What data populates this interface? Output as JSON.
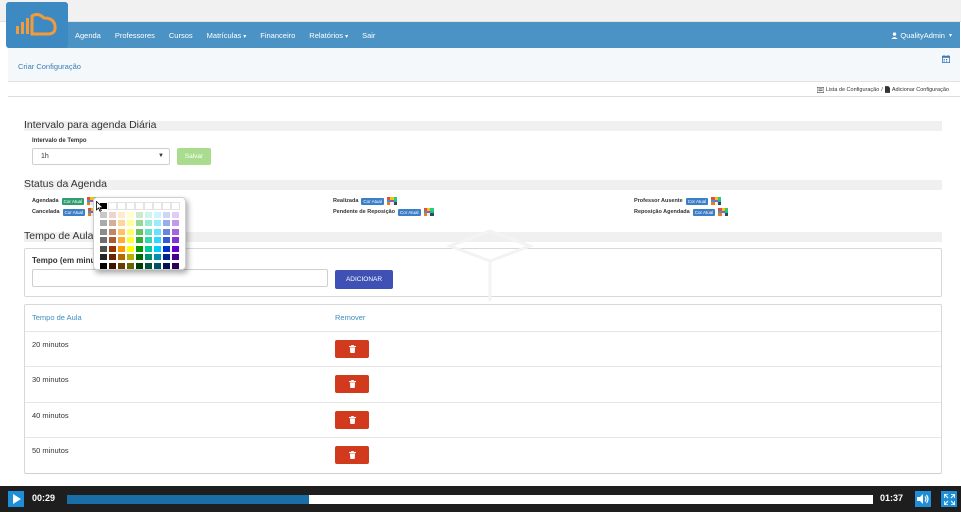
{
  "navbar": {
    "items": [
      {
        "label": "Agenda",
        "dropdown": false
      },
      {
        "label": "Professores",
        "dropdown": false
      },
      {
        "label": "Cursos",
        "dropdown": false
      },
      {
        "label": "Matrículas",
        "dropdown": true
      },
      {
        "label": "Financeiro",
        "dropdown": false
      },
      {
        "label": "Relatórios",
        "dropdown": true
      },
      {
        "label": "Sair",
        "dropdown": false
      }
    ],
    "user": "QualityAdmin",
    "caret": "▾"
  },
  "subheader": {
    "title": "Criar Configuração"
  },
  "breadcrumb": {
    "list": "Lista de Configuração",
    "separator": "/",
    "add": "Adicionar Configuração"
  },
  "intervalo": {
    "title": "Intervalo para agenda Diária",
    "label": "Intervalo de Tempo",
    "select_value": "1h",
    "save_label": "Salvar"
  },
  "status": {
    "title": "Status da Agenda",
    "badge_label": "Cor Atual",
    "items": [
      {
        "label": "Agendada",
        "badge_color": "#2e9d6f"
      },
      {
        "label": "Cancelada",
        "badge_color": "#3d7fc6"
      },
      {
        "label": "Realizada",
        "badge_color": "#3d7fc6"
      },
      {
        "label": "Pendente de Reposição",
        "badge_color": "#3d7fc6"
      },
      {
        "label": "Professor Ausente",
        "badge_color": "#3d7fc6"
      },
      {
        "label": "Reposição Agendada",
        "badge_color": "#3d7fc6"
      }
    ]
  },
  "tempo_aula": {
    "title": "Tempo de Aula",
    "input_label": "Tempo (em minutos)",
    "add_label": "ADICIONAR"
  },
  "table": {
    "headers": [
      "Tempo de Aula",
      "Remover"
    ],
    "rows": [
      "20 minutos",
      "30 minutos",
      "40 minutos",
      "50 minutos"
    ]
  },
  "player": {
    "current_time": "00:29",
    "duration": "01:37",
    "progress_fraction": 0.3
  },
  "colors": {
    "navbar": "#4b93c4",
    "accent_blue": "#3f51b5",
    "danger": "#d23a1e",
    "success_light": "#a9dc8c",
    "link": "#3a7cb8"
  },
  "icons": [
    "cloud-logo-icon",
    "user-icon",
    "calendar-icon",
    "list-icon",
    "file-icon",
    "palette-icon",
    "trash-icon",
    "play-icon",
    "volume-icon",
    "fullscreen-icon",
    "mouse-cursor-icon"
  ]
}
